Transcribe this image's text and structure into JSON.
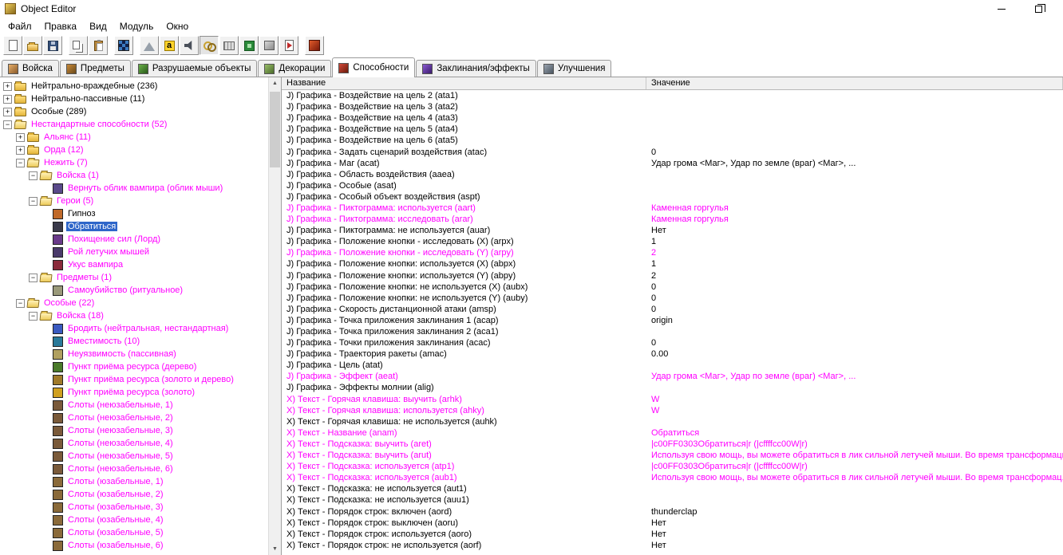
{
  "window": {
    "title": "Object Editor"
  },
  "menu": {
    "items": [
      "Файл",
      "Правка",
      "Вид",
      "Модуль",
      "Окно"
    ]
  },
  "toolbar": {
    "buttons": [
      {
        "name": "new-map-button",
        "icon": "new"
      },
      {
        "name": "open-map-button",
        "icon": "open"
      },
      {
        "name": "save-map-button",
        "icon": "save"
      },
      {
        "name": "copy-button",
        "icon": "copy",
        "sep": true
      },
      {
        "name": "paste-button",
        "icon": "paste"
      },
      {
        "name": "checkerboard-button",
        "icon": "checker",
        "sep": true
      },
      {
        "name": "terrain-editor-button",
        "icon": "terrain",
        "sep": true
      },
      {
        "name": "trigger-editor-button",
        "icon": "trigger"
      },
      {
        "name": "sound-editor-button",
        "icon": "sound"
      },
      {
        "name": "object-editor-button",
        "icon": "rings",
        "pressed": true
      },
      {
        "name": "campaign-editor-button",
        "icon": "abacus"
      },
      {
        "name": "ai-editor-button",
        "icon": "ai"
      },
      {
        "name": "object-manager-button",
        "icon": "box"
      },
      {
        "name": "import-manager-button",
        "icon": "import"
      },
      {
        "name": "test-map-button",
        "icon": "test",
        "sep": true
      }
    ]
  },
  "tabs": [
    {
      "label": "Войска",
      "icon": "units",
      "active": false
    },
    {
      "label": "Предметы",
      "icon": "items",
      "active": false
    },
    {
      "label": "Разрушаемые объекты",
      "icon": "destructibles",
      "active": false
    },
    {
      "label": "Декорации",
      "icon": "doodads",
      "active": false
    },
    {
      "label": "Способности",
      "icon": "abilities",
      "active": true
    },
    {
      "label": "Заклинания/эффекты",
      "icon": "buffs",
      "active": false
    },
    {
      "label": "Улучшения",
      "icon": "upgrades",
      "active": false
    }
  ],
  "colors": {
    "modified": "#ff00ff",
    "selection": "#2e66c9"
  },
  "tree": {
    "items": [
      {
        "label": "Нейтрально-враждебные (236)",
        "level": 0,
        "toggle": "plus",
        "icon": "folder-closed",
        "modified": false
      },
      {
        "label": "Нейтрально-пассивные (11)",
        "level": 0,
        "toggle": "plus",
        "icon": "folder-closed",
        "modified": false
      },
      {
        "label": "Особые (289)",
        "level": 0,
        "toggle": "plus",
        "icon": "folder-closed",
        "modified": false
      },
      {
        "label": "Нестандартные способности (52)",
        "level": 0,
        "toggle": "minus",
        "icon": "folder-open",
        "modified": true
      },
      {
        "label": "Альянс (11)",
        "level": 1,
        "toggle": "plus",
        "icon": "folder-closed",
        "modified": true
      },
      {
        "label": "Орда (12)",
        "level": 1,
        "toggle": "plus",
        "icon": "folder-closed",
        "modified": true
      },
      {
        "label": "Нежить (7)",
        "level": 1,
        "toggle": "minus",
        "icon": "folder-open",
        "modified": true
      },
      {
        "label": "Войска (1)",
        "level": 2,
        "toggle": "minus",
        "icon": "folder-open",
        "modified": true
      },
      {
        "label": "Вернуть облик вампира (облик мыши)",
        "level": 3,
        "toggle": "none",
        "icon": "leaf",
        "icon_color": "#5a4a8a",
        "modified": true
      },
      {
        "label": "Герои (5)",
        "level": 2,
        "toggle": "minus",
        "icon": "folder-open",
        "modified": true
      },
      {
        "label": "Гипноз",
        "level": 3,
        "toggle": "none",
        "icon": "leaf",
        "icon_color": "#c06a2a",
        "modified": false
      },
      {
        "label": "Обратиться",
        "level": 3,
        "toggle": "none",
        "icon": "leaf",
        "icon_color": "#3a3a4a",
        "modified": true,
        "selected": true
      },
      {
        "label": "Похищение сил (Лорд)",
        "level": 3,
        "toggle": "none",
        "icon": "leaf",
        "icon_color": "#6a3a8a",
        "modified": true
      },
      {
        "label": "Рой летучих мышей",
        "level": 3,
        "toggle": "none",
        "icon": "leaf",
        "icon_color": "#4a3a6a",
        "modified": true
      },
      {
        "label": "Укус вампира",
        "level": 3,
        "toggle": "none",
        "icon": "leaf",
        "icon_color": "#8a2a3a",
        "modified": true
      },
      {
        "label": "Предметы (1)",
        "level": 2,
        "toggle": "minus",
        "icon": "folder-open",
        "modified": true
      },
      {
        "label": "Самоубийство (ритуальное)",
        "level": 3,
        "toggle": "none",
        "icon": "leaf",
        "icon_color": "#9a9a7a",
        "modified": true
      },
      {
        "label": "Особые (22)",
        "level": 1,
        "toggle": "minus",
        "icon": "folder-open",
        "modified": true
      },
      {
        "label": "Войска (18)",
        "level": 2,
        "toggle": "minus",
        "icon": "folder-open",
        "modified": true
      },
      {
        "label": "Бродить (нейтральная, нестандартная)",
        "level": 3,
        "toggle": "none",
        "icon": "leaf",
        "icon_color": "#3a5ac0",
        "modified": true
      },
      {
        "label": "Вместимость (10)",
        "level": 3,
        "toggle": "none",
        "icon": "leaf",
        "icon_color": "#2a7a9a",
        "modified": true
      },
      {
        "label": "Неуязвимость (пассивная)",
        "level": 3,
        "toggle": "none",
        "icon": "leaf",
        "icon_color": "#b0a060",
        "modified": true
      },
      {
        "label": "Пункт приёма ресурса (дерево)",
        "level": 3,
        "toggle": "none",
        "icon": "leaf",
        "icon_color": "#4a7a2a",
        "modified": true
      },
      {
        "label": "Пункт приёма ресурса (золото и дерево)",
        "level": 3,
        "toggle": "none",
        "icon": "leaf",
        "icon_color": "#a07a2a",
        "modified": true
      },
      {
        "label": "Пункт приёма ресурса (золото)",
        "level": 3,
        "toggle": "none",
        "icon": "leaf",
        "icon_color": "#d0a020",
        "modified": true
      },
      {
        "label": "Слоты (неюзабельные, 1)",
        "level": 3,
        "toggle": "none",
        "icon": "leaf",
        "icon_color": "#7a5a3a",
        "modified": true
      },
      {
        "label": "Слоты (неюзабельные, 2)",
        "level": 3,
        "toggle": "none",
        "icon": "leaf",
        "icon_color": "#7a5a3a",
        "modified": true
      },
      {
        "label": "Слоты (неюзабельные, 3)",
        "level": 3,
        "toggle": "none",
        "icon": "leaf",
        "icon_color": "#7a5a3a",
        "modified": true
      },
      {
        "label": "Слоты (неюзабельные, 4)",
        "level": 3,
        "toggle": "none",
        "icon": "leaf",
        "icon_color": "#7a5a3a",
        "modified": true
      },
      {
        "label": "Слоты (неюзабельные, 5)",
        "level": 3,
        "toggle": "none",
        "icon": "leaf",
        "icon_color": "#7a5a3a",
        "modified": true
      },
      {
        "label": "Слоты (неюзабельные, 6)",
        "level": 3,
        "toggle": "none",
        "icon": "leaf",
        "icon_color": "#7a5a3a",
        "modified": true
      },
      {
        "label": "Слоты (юзабельные, 1)",
        "level": 3,
        "toggle": "none",
        "icon": "leaf",
        "icon_color": "#8a6a3a",
        "modified": true
      },
      {
        "label": "Слоты (юзабельные, 2)",
        "level": 3,
        "toggle": "none",
        "icon": "leaf",
        "icon_color": "#8a6a3a",
        "modified": true
      },
      {
        "label": "Слоты (юзабельные, 3)",
        "level": 3,
        "toggle": "none",
        "icon": "leaf",
        "icon_color": "#8a6a3a",
        "modified": true
      },
      {
        "label": "Слоты (юзабельные, 4)",
        "level": 3,
        "toggle": "none",
        "icon": "leaf",
        "icon_color": "#8a6a3a",
        "modified": true
      },
      {
        "label": "Слоты (юзабельные, 5)",
        "level": 3,
        "toggle": "none",
        "icon": "leaf",
        "icon_color": "#8a6a3a",
        "modified": true
      },
      {
        "label": "Слоты (юзабельные, 6)",
        "level": 3,
        "toggle": "none",
        "icon": "leaf",
        "icon_color": "#8a6a3a",
        "modified": true
      }
    ]
  },
  "table": {
    "columns": [
      "Название",
      "Значение"
    ],
    "rows": [
      {
        "name": "J) Графика - Воздействие на цель 2 (ata1)",
        "value": "",
        "modified": false
      },
      {
        "name": "J) Графика - Воздействие на цель 3 (ata2)",
        "value": "",
        "modified": false
      },
      {
        "name": "J) Графика - Воздействие на цель 4 (ata3)",
        "value": "",
        "modified": false
      },
      {
        "name": "J) Графика - Воздействие на цель 5 (ata4)",
        "value": "",
        "modified": false
      },
      {
        "name": "J) Графика - Воздействие на цель 6 (ata5)",
        "value": "",
        "modified": false
      },
      {
        "name": "J) Графика - Задать сценарий воздействия (atac)",
        "value": "0",
        "modified": false
      },
      {
        "name": "J) Графика - Маг (acat)",
        "value": "Удар грома <Маг>, Удар по земле (враг) <Маг>, ...",
        "modified": false
      },
      {
        "name": "J) Графика - Область воздействия (aaea)",
        "value": "",
        "modified": false
      },
      {
        "name": "J) Графика - Особые (asat)",
        "value": "",
        "modified": false
      },
      {
        "name": "J) Графика - Особый объект воздействия (aspt)",
        "value": "",
        "modified": false
      },
      {
        "name": "J) Графика - Пиктограмма: используется (aart)",
        "value": "Каменная горгулья",
        "modified": true
      },
      {
        "name": "J) Графика - Пиктограмма: исследовать (arar)",
        "value": "Каменная горгулья",
        "modified": true
      },
      {
        "name": "J) Графика - Пиктограмма: не используется (auar)",
        "value": "Нет",
        "modified": false
      },
      {
        "name": "J) Графика - Положение кнопки - исследовать (X) (arpx)",
        "value": "1",
        "modified": false
      },
      {
        "name": "J) Графика - Положение кнопки - исследовать (Y) (arpy)",
        "value": "2",
        "modified": true
      },
      {
        "name": "J) Графика - Положение кнопки: используется (X) (abpx)",
        "value": "1",
        "modified": false
      },
      {
        "name": "J) Графика - Положение кнопки: используется (Y) (abpy)",
        "value": "2",
        "modified": false
      },
      {
        "name": "J) Графика - Положение кнопки: не используется (X) (aubx)",
        "value": "0",
        "modified": false
      },
      {
        "name": "J) Графика - Положение кнопки: не используется (Y) (auby)",
        "value": "0",
        "modified": false
      },
      {
        "name": "J) Графика - Скорость дистанционной атаки (amsp)",
        "value": "0",
        "modified": false
      },
      {
        "name": "J) Графика - Точка приложения заклинания 1 (acap)",
        "value": "origin",
        "modified": false
      },
      {
        "name": "J) Графика - Точка приложения заклинания 2 (aca1)",
        "value": "",
        "modified": false
      },
      {
        "name": "J) Графика - Точки приложения заклинания (acac)",
        "value": "0",
        "modified": false
      },
      {
        "name": "J) Графика - Траектория ракеты (amac)",
        "value": "0.00",
        "modified": false
      },
      {
        "name": "J) Графика - Цель (atat)",
        "value": "",
        "modified": false
      },
      {
        "name": "J) Графика - Эффект (aeat)",
        "value": "Удар грома <Маг>, Удар по земле (враг) <Маг>, ...",
        "modified": true
      },
      {
        "name": "J) Графика - Эффекты молнии (alig)",
        "value": "",
        "modified": false
      },
      {
        "name": "X) Текст - Горячая клавиша: выучить (arhk)",
        "value": "W",
        "modified": true
      },
      {
        "name": "X) Текст - Горячая клавиша: используется (ahky)",
        "value": "W",
        "modified": true
      },
      {
        "name": "X) Текст - Горячая клавиша: не используется (auhk)",
        "value": "",
        "modified": false
      },
      {
        "name": "X) Текст - Название (anam)",
        "value": "Обратиться",
        "modified": true
      },
      {
        "name": "X) Текст - Подсказка: выучить (aret)",
        "value": "|c00FF0303Обратиться|r (|cffffcc00W|r)",
        "modified": true
      },
      {
        "name": "X) Текст - Подсказка: выучить (arut)",
        "value": "Используя свою мощь, вы можете обратиться в лик сильной летучей мыши. Во время трансформаци...",
        "modified": true
      },
      {
        "name": "X) Текст - Подсказка: используется (atp1)",
        "value": "|c00FF0303Обратиться|r (|cffffcc00W|r)",
        "modified": true
      },
      {
        "name": "X) Текст - Подсказка: используется (aub1)",
        "value": "Используя свою мощь, вы можете обратиться в лик сильной летучей мыши. Во время трансформац...",
        "modified": true
      },
      {
        "name": "X) Текст - Подсказка: не используется (aut1)",
        "value": "",
        "modified": false
      },
      {
        "name": "X) Текст - Подсказка: не используется (auu1)",
        "value": "",
        "modified": false
      },
      {
        "name": "X) Текст - Порядок строк: включен (aord)",
        "value": "thunderclap",
        "modified": false
      },
      {
        "name": "X) Текст - Порядок строк: выключен (aoru)",
        "value": "Нет",
        "modified": false
      },
      {
        "name": "X) Текст - Порядок строк: используется (aoro)",
        "value": "Нет",
        "modified": false
      },
      {
        "name": "X) Текст - Порядок строк: не используется (aorf)",
        "value": "Нет",
        "modified": false
      }
    ]
  }
}
